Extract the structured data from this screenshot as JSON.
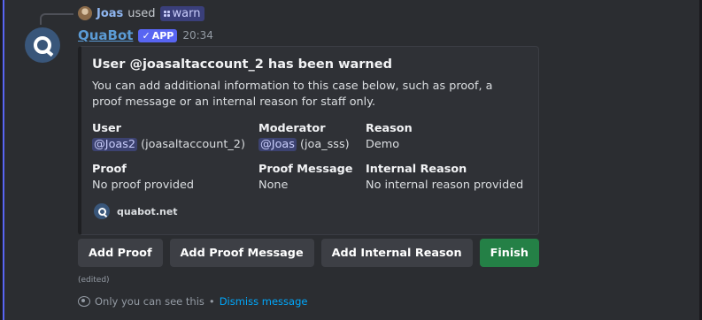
{
  "reply": {
    "user": "Joas",
    "used_text": "used",
    "command": "warn"
  },
  "message": {
    "bot_name": "QuaBot",
    "badge": "APP",
    "timestamp": "20:34",
    "edited": "(edited)"
  },
  "embed": {
    "title": "User @joasaltaccount_2 has been warned",
    "description": "You can add additional information to this case below, such as proof, a proof message or an internal reason for staff only.",
    "fields": {
      "user": {
        "name": "User",
        "mention": "@Joas2",
        "rest": " (joasaltaccount_2)"
      },
      "moderator": {
        "name": "Moderator",
        "mention": "@Joas",
        "rest": " (joa_sss)"
      },
      "reason": {
        "name": "Reason",
        "value": "Demo"
      },
      "proof": {
        "name": "Proof",
        "value": "No proof provided"
      },
      "proof_message": {
        "name": "Proof Message",
        "value": "None"
      },
      "internal_reason": {
        "name": "Internal Reason",
        "value": "No internal reason provided"
      }
    },
    "footer": "quabot.net"
  },
  "buttons": {
    "add_proof": "Add Proof",
    "add_proof_message": "Add Proof Message",
    "add_internal_reason": "Add Internal Reason",
    "finish": "Finish"
  },
  "ephemeral": {
    "text": "Only you can see this",
    "separator": "•",
    "dismiss": "Dismiss message"
  },
  "colors": {
    "accent": "#5865f2",
    "finish": "#248046",
    "link": "#00a8fc"
  }
}
